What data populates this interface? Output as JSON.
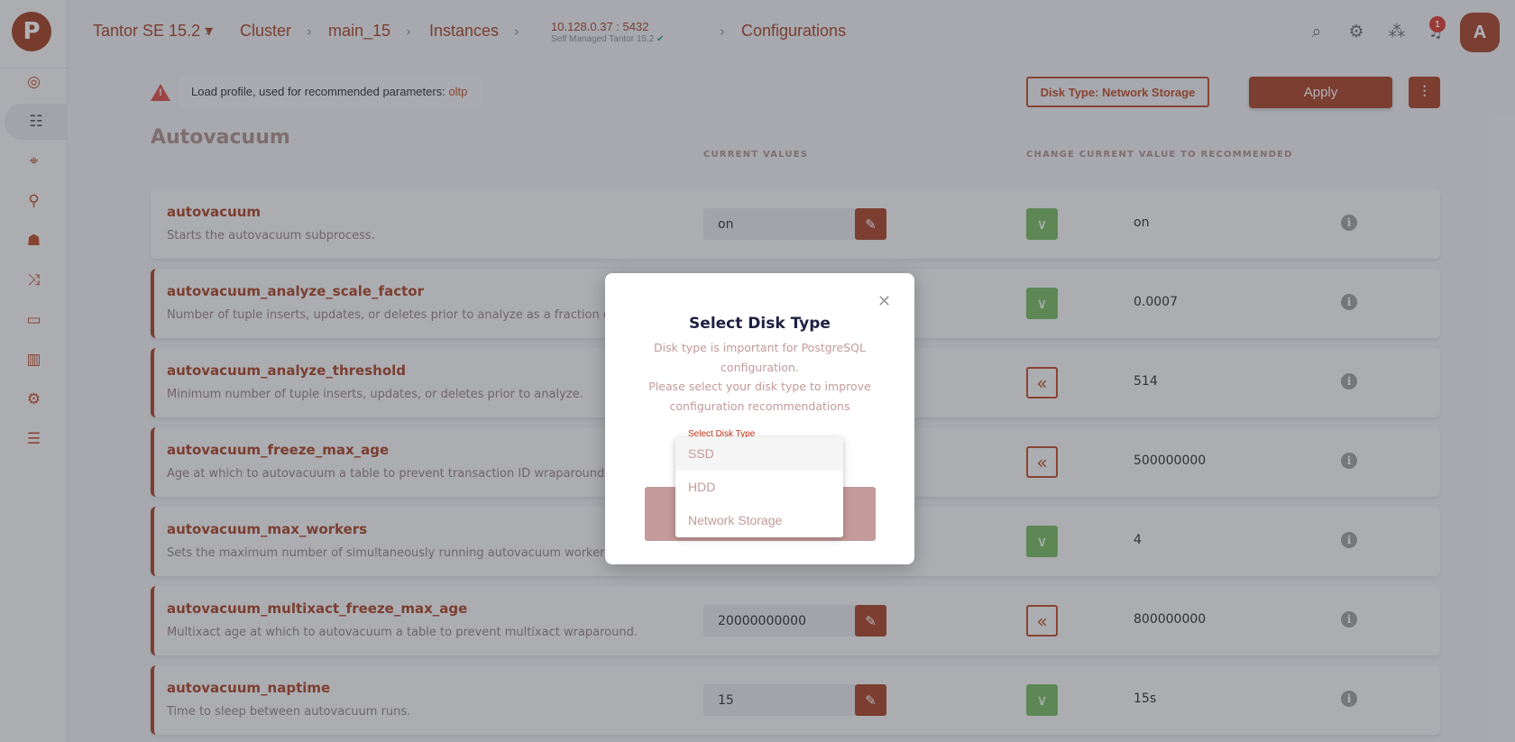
{
  "sidebar": {
    "logo": "P",
    "items": [
      {
        "icon": "radar-icon",
        "glyph": "◎"
      },
      {
        "icon": "sliders-icon",
        "glyph": "☷"
      },
      {
        "icon": "telescope-icon",
        "glyph": "⌖"
      },
      {
        "icon": "microscope-icon",
        "glyph": "⚲"
      },
      {
        "icon": "users-board-icon",
        "glyph": "☗"
      },
      {
        "icon": "shuffle-icon",
        "glyph": "⤨"
      },
      {
        "icon": "folders-icon",
        "glyph": "▭"
      },
      {
        "icon": "bar-chart-icon",
        "glyph": "▥"
      },
      {
        "icon": "gear-icon",
        "glyph": "⚙"
      },
      {
        "icon": "server-icon",
        "glyph": "☰"
      }
    ]
  },
  "header": {
    "breadcrumb": [
      "Tantor SE 15.2 ▾",
      "Cluster",
      "main_15",
      "Instances",
      "Configurations"
    ],
    "instance": {
      "address": "10.128.0.37 : 5432",
      "subtitle": "Self Managed Tantor 15.2",
      "status_glyph": "✔"
    },
    "notifications_count": "1",
    "avatar": "A"
  },
  "toolbar": {
    "warning": "Load profile, used for recommended parameters: ",
    "profile": "oltp",
    "disk_type_label": "Disk Type: Network Storage",
    "apply_label": "Apply"
  },
  "section": {
    "title": "Autovacuum",
    "col_current": "CURRENT VALUES",
    "col_change": "CHANGE CURRENT VALUE TO RECOMMENDED"
  },
  "colors": {
    "accent": "#a3381a",
    "ok": "#6fb556"
  },
  "params": [
    {
      "name": "autovacuum",
      "desc": "Starts the autovacuum subprocess.",
      "current": "on",
      "action": "ok",
      "recommended": "on",
      "modified": false
    },
    {
      "name": "autovacuum_analyze_scale_factor",
      "desc": "Number of tuple inserts, updates, or deletes prior to analyze as a fraction of",
      "current": null,
      "action": "ok",
      "recommended": "0.0007",
      "modified": true
    },
    {
      "name": "autovacuum_analyze_threshold",
      "desc": "Minimum number of tuple inserts, updates, or deletes prior to analyze.",
      "current": null,
      "action": "back",
      "recommended": "514",
      "modified": true
    },
    {
      "name": "autovacuum_freeze_max_age",
      "desc": "Age at which to autovacuum a table to prevent transaction ID wraparound.",
      "current": null,
      "action": "back",
      "recommended": "500000000",
      "modified": true
    },
    {
      "name": "autovacuum_max_workers",
      "desc": "Sets the maximum number of simultaneously running autovacuum worker",
      "current": null,
      "action": "ok",
      "recommended": "4",
      "modified": true
    },
    {
      "name": "autovacuum_multixact_freeze_max_age",
      "desc": "Multixact age at which to autovacuum a table to prevent multixact wraparound.",
      "current": "20000000000",
      "action": "back",
      "recommended": "800000000",
      "modified": true
    },
    {
      "name": "autovacuum_naptime",
      "desc": "Time to sleep between autovacuum runs.",
      "current": "15",
      "action": "ok",
      "recommended": "15s",
      "modified": true
    }
  ],
  "modal": {
    "title": "Select Disk Type",
    "lines": [
      "Disk type is important for PostgreSQL",
      "configuration.",
      "Please select your disk type to improve",
      "configuration recommendations"
    ],
    "select_label": "Select Disk Type",
    "options": [
      "SSD",
      "HDD",
      "Network Storage"
    ],
    "highlighted": "SSD"
  }
}
